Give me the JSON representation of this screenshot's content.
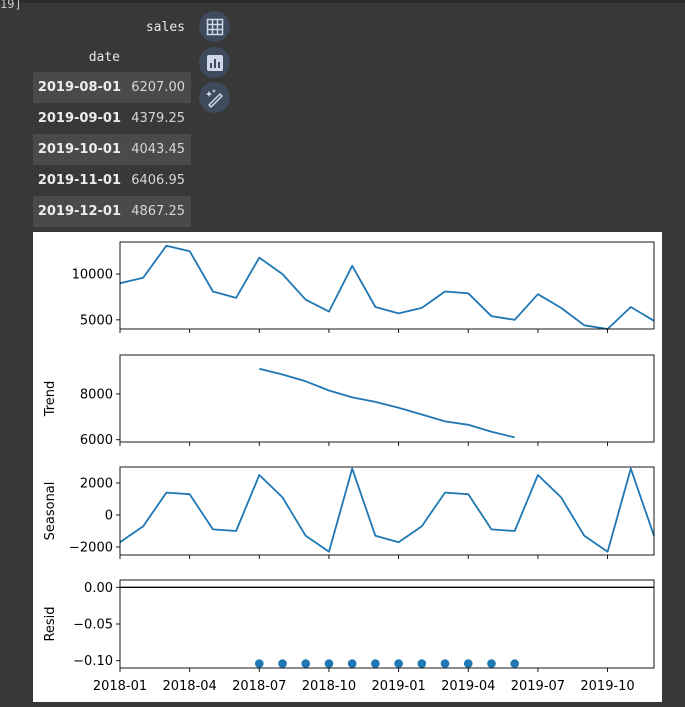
{
  "cell": {
    "execution_label": "19]"
  },
  "dataframe": {
    "column_header": "sales",
    "index_name": "date",
    "rows": [
      {
        "date": "2019-08-01",
        "sales": "6207.00"
      },
      {
        "date": "2019-09-01",
        "sales": "4379.25"
      },
      {
        "date": "2019-10-01",
        "sales": "4043.45"
      },
      {
        "date": "2019-11-01",
        "sales": "6406.95"
      },
      {
        "date": "2019-12-01",
        "sales": "4867.25"
      }
    ]
  },
  "toolbar": {
    "icons": [
      "table-icon",
      "chart-icon",
      "magic-wand-icon"
    ]
  },
  "chart_data": {
    "type": "line",
    "description_kind": "seasonal decomposition",
    "x_tick_labels": [
      "2018-01",
      "2018-04",
      "2018-07",
      "2018-10",
      "2019-01",
      "2019-04",
      "2019-07",
      "2019-10"
    ],
    "x_dates": [
      "2018-01",
      "2018-02",
      "2018-03",
      "2018-04",
      "2018-05",
      "2018-06",
      "2018-07",
      "2018-08",
      "2018-09",
      "2018-10",
      "2018-11",
      "2018-12",
      "2019-01",
      "2019-02",
      "2019-03",
      "2019-04",
      "2019-05",
      "2019-06",
      "2019-07",
      "2019-08",
      "2019-09",
      "2019-10",
      "2019-11",
      "2019-12"
    ],
    "color": "#1f77b4",
    "panels": [
      {
        "ylabel": "",
        "ylim": [
          4000,
          13500
        ],
        "yticks": [
          5000,
          10000
        ],
        "ytick_labels": [
          "5000",
          "10000"
        ],
        "values": [
          9000,
          9600,
          13100,
          12500,
          8100,
          7400,
          11800,
          10000,
          7200,
          5900,
          10900,
          6400,
          5700,
          6300,
          8100,
          7900,
          5400,
          5000,
          7800,
          6300,
          4400,
          4000,
          6400,
          4900
        ]
      },
      {
        "ylabel": "Trend",
        "ylim": [
          5900,
          9700
        ],
        "yticks": [
          6000,
          8000
        ],
        "ytick_labels": [
          "6000",
          "8000"
        ],
        "values": [
          null,
          null,
          null,
          null,
          null,
          null,
          9100,
          8850,
          8550,
          8150,
          7850,
          7650,
          7400,
          7100,
          6800,
          6650,
          6350,
          6100,
          null,
          null,
          null,
          null,
          null,
          null
        ]
      },
      {
        "ylabel": "Seasonal",
        "ylim": [
          -2500,
          3000
        ],
        "yticks": [
          -2000,
          0,
          2000
        ],
        "ytick_labels": [
          "−2000",
          "0",
          "2000"
        ],
        "values": [
          -1700,
          -700,
          1400,
          1300,
          -900,
          -1000,
          2500,
          1100,
          -1300,
          -2300,
          2900,
          -1300,
          -1700,
          -700,
          1400,
          1300,
          -900,
          -1000,
          2500,
          1100,
          -1300,
          -2300,
          2900,
          -1300
        ]
      },
      {
        "ylabel": "Resid",
        "ylim": [
          -0.11,
          0.01
        ],
        "yticks": [
          -0.1,
          -0.05,
          0.0
        ],
        "ytick_labels": [
          "−0.10",
          "−0.05",
          "0.00"
        ],
        "zero_line": true,
        "marker": "dot",
        "values": [
          null,
          null,
          null,
          null,
          null,
          null,
          -0.104,
          -0.104,
          -0.104,
          -0.104,
          -0.104,
          -0.104,
          -0.104,
          -0.104,
          -0.104,
          -0.104,
          -0.104,
          -0.104,
          null,
          null,
          null,
          null,
          null,
          null
        ]
      }
    ]
  }
}
